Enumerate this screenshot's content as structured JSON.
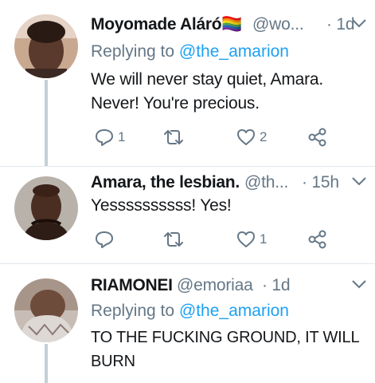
{
  "tweets": [
    {
      "name": "Moyomade Aláró🏳️‍🌈",
      "handle": "@wo...",
      "time": "· 1d",
      "replying_prefix": "Replying to ",
      "replying_to": "@the_amarion",
      "text_lines": [
        "We will never stay quiet, Amara.",
        "Never! You're precious."
      ],
      "reply_count": "1",
      "retweet_count": "",
      "like_count": "2"
    },
    {
      "name": "Amara, the lesbian.",
      "handle": "@th...",
      "time": "· 15h",
      "text_lines": [
        "Yessssssssss! Yes!"
      ],
      "reply_count": "",
      "retweet_count": "",
      "like_count": "1"
    },
    {
      "name": "RIAMONEI",
      "handle": "@emoriaa",
      "time": "· 1d",
      "replying_prefix": "Replying to ",
      "replying_to": "@the_amarion",
      "text_lines": [
        "TO THE FUCKING GROUND, IT WILL",
        "BURN"
      ]
    }
  ],
  "icons": {
    "reply": "reply-icon",
    "retweet": "retweet-icon",
    "like": "heart-icon",
    "share": "share-icon",
    "more": "chevron-down-icon"
  },
  "colors": {
    "text": "#14171a",
    "muted": "#657786",
    "link": "#1da1f2",
    "thread": "#c4cfd6",
    "divider": "#e1e8ed"
  }
}
